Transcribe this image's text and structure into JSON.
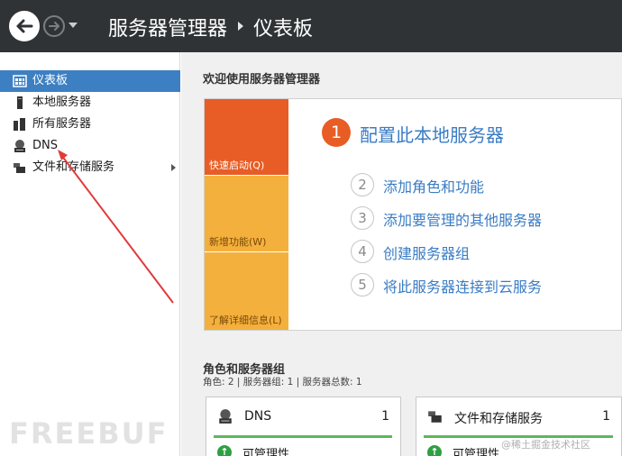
{
  "header": {
    "app_title": "服务器管理器",
    "page_title": "仪表板"
  },
  "sidebar": {
    "items": [
      {
        "label": "仪表板",
        "icon": "dashboard-icon",
        "active": true
      },
      {
        "label": "本地服务器",
        "icon": "server-icon"
      },
      {
        "label": "所有服务器",
        "icon": "servers-icon"
      },
      {
        "label": "DNS",
        "icon": "dns-icon"
      },
      {
        "label": "文件和存储服务",
        "icon": "storage-icon",
        "has_submenu": true
      }
    ]
  },
  "welcome": {
    "title": "欢迎使用服务器管理器",
    "tiles": [
      "快速启动(Q)",
      "新增功能(W)",
      "了解详细信息(L)"
    ],
    "steps": [
      {
        "number": "1",
        "label": "配置此本地服务器"
      },
      {
        "number": "2",
        "label": "添加角色和功能"
      },
      {
        "number": "3",
        "label": "添加要管理的其他服务器"
      },
      {
        "number": "4",
        "label": "创建服务器组"
      },
      {
        "number": "5",
        "label": "将此服务器连接到云服务"
      }
    ]
  },
  "roles": {
    "title": "角色和服务器组",
    "summary": "角色: 2 | 服务器组: 1 | 服务器总数: 1",
    "cards": [
      {
        "name": "DNS",
        "count": "1",
        "status": "可管理性",
        "icon": "dns-icon"
      },
      {
        "name": "文件和存储服务",
        "count": "1",
        "status": "可管理性",
        "icon": "storage-icon"
      }
    ]
  },
  "watermarks": {
    "left": "FREEBUF",
    "right": "@稀土掘金技术社区"
  },
  "colors": {
    "header_bg": "#2f3336",
    "active_item": "#3c7fc2",
    "quick_start_tile": "#e85d25",
    "secondary_tile": "#f4b03d",
    "link_text": "#3a7cc4",
    "status_green": "#5cb85c",
    "annotation_arrow": "#e03b3b"
  }
}
